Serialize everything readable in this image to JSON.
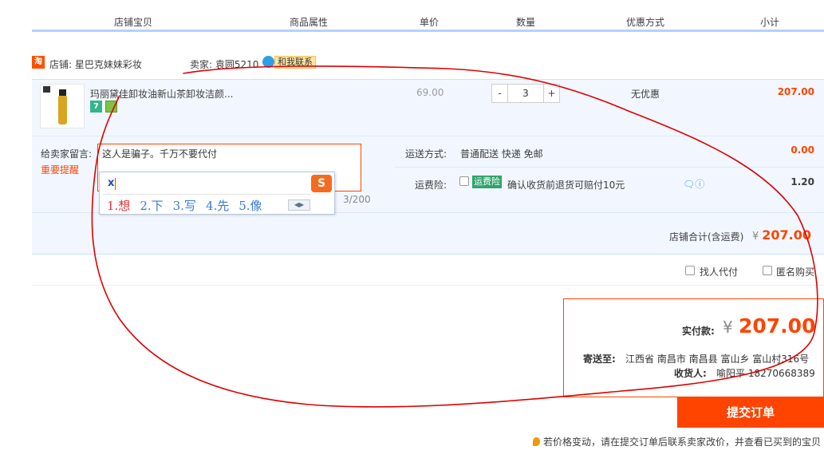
{
  "header": {
    "col_item": "店铺宝贝",
    "col_attr": "商品属性",
    "col_price": "单价",
    "col_qty": "数量",
    "col_discount": "优惠方式",
    "col_subtotal": "小计"
  },
  "shop": {
    "logo_text": "淘",
    "name": "店铺: 星巴克妹妹彩妆",
    "seller": "卖家: 袁圆5210",
    "contact_label": "和我联系"
  },
  "item": {
    "title": "玛丽黛佳卸妆油新山茶卸妆洁颜...",
    "badge_7": "7",
    "price": "69.00",
    "qty_minus": "-",
    "qty_value": "3",
    "qty_plus": "+",
    "discount": "无优惠",
    "subtotal": "207.00"
  },
  "message": {
    "label": "给卖家留言:",
    "warning": "重要提醒",
    "value": "这人是骗子。千万不要代付",
    "count": "3/200"
  },
  "shipping": {
    "label": "运送方式:",
    "value": "普通配送 快递 免邮",
    "fee": "0.00"
  },
  "insurance": {
    "label": "运费险:",
    "tag": "运费险",
    "text": "确认收货前退货可赔付10元",
    "fee": "1.20"
  },
  "shop_total": {
    "label": "店铺合计(含运费)",
    "yen": "¥",
    "value": "207.00"
  },
  "ime": {
    "input": "x",
    "logo": "S",
    "candidates": [
      "1.想",
      "2.下",
      "3.写",
      "4.先",
      "5.像"
    ]
  },
  "options": {
    "proxy_pay": "找人代付",
    "anonymous": "匿名购买"
  },
  "summary": {
    "pay_label": "实付款:",
    "yen": "¥",
    "amount": "207.00",
    "address_label": "寄送至:",
    "address": "江西省 南昌市 南昌县 富山乡 富山村316号",
    "receiver_label": "收货人:",
    "receiver": "喻阳平 18270668389"
  },
  "submit_label": "提交订单",
  "note": "若价格变动，请在提交订单后联系卖家改价，并查看已买到的宝贝",
  "colors": {
    "accent": "#ff4400",
    "header_border": "#b2d1ff",
    "row_bg": "#f2f7ff",
    "annotation": "#e00000"
  }
}
